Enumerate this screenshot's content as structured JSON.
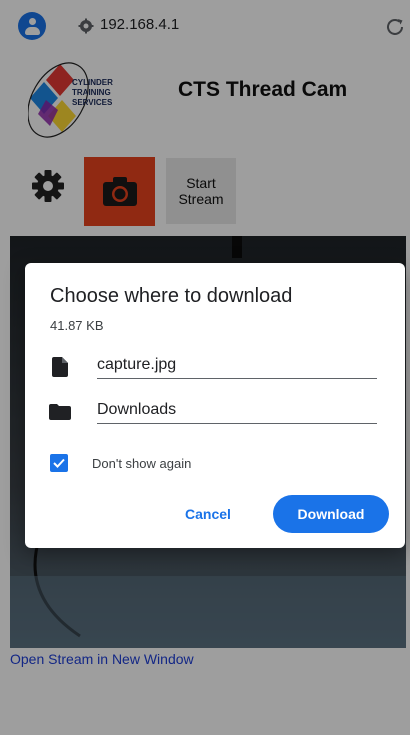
{
  "browser": {
    "url": "192.168.4.1",
    "reload_icon": "reload-icon",
    "profile_icon": "profile-icon"
  },
  "page": {
    "logo_text": [
      "CYLINDER",
      "TRAINING",
      "SERVICES"
    ],
    "title": "CTS Thread Cam",
    "stream_button": "Start Stream",
    "stream_link": "Open Stream in New Window",
    "colors": {
      "capture_button": "#e8431d",
      "link": "#1f3fd8"
    }
  },
  "dialog": {
    "title": "Choose where to download",
    "file_size": "41.87 KB",
    "filename": "capture.jpg",
    "location": "Downloads",
    "checkbox_label": "Don't show again",
    "checkbox_checked": true,
    "cancel_label": "Cancel",
    "download_label": "Download",
    "accent": "#1a73e8"
  }
}
